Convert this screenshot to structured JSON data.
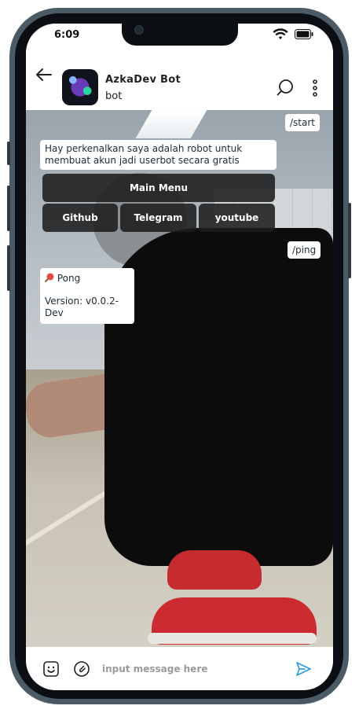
{
  "status_bar": {
    "time": "6:09"
  },
  "header": {
    "bot_name": "AzkaDev Bot",
    "bot_status": "bot"
  },
  "messages": {
    "start_cmd": "/start",
    "welcome": "Hay perkenalkan saya adalah robot untuk membuat akun jadi userbot secara gratis",
    "main_menu": "Main Menu",
    "buttons": [
      "Github",
      "Telegram",
      "youtube"
    ],
    "ping_cmd": "/ping",
    "pong": "Pong",
    "version": "Version: v0.0.2-Dev"
  },
  "input": {
    "placeholder": "input message here"
  },
  "colors": {
    "accent": "#2f9be0",
    "keyboard_button": "#1e1e1e"
  }
}
